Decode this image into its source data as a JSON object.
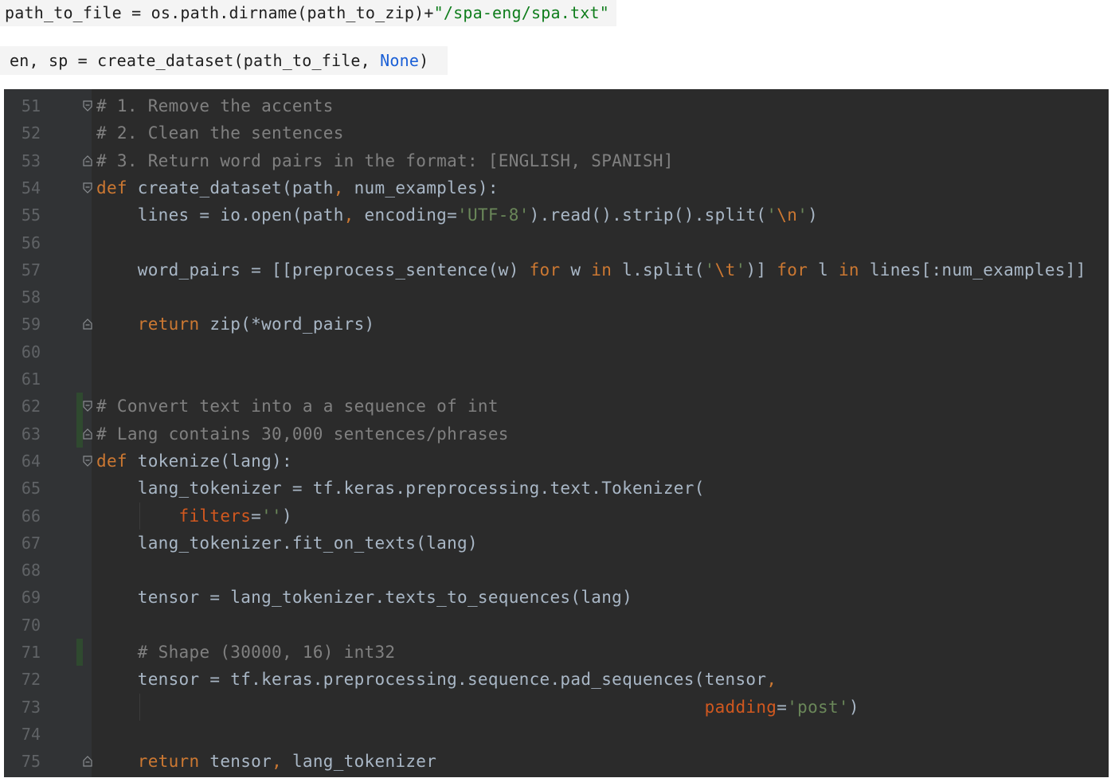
{
  "snippets": [
    {
      "parts": [
        {
          "text": "path_to_file = os.path.dirname(path_to_zip)+",
          "kind": "plain"
        },
        {
          "text": "\"/spa-eng/spa.txt\"",
          "kind": "string"
        }
      ]
    },
    {
      "parts": [
        {
          "text": "en, sp = create_dataset(path_to_file, ",
          "kind": "plain"
        },
        {
          "text": "None",
          "kind": "keyword"
        },
        {
          "text": ")",
          "kind": "plain"
        }
      ]
    }
  ],
  "editor": {
    "colors": {
      "background": "#2b2b2b",
      "gutter": "#313335",
      "text": "#a9b7c6",
      "comment": "#808080",
      "keyword": "#cc7832",
      "string": "#6a8759",
      "named_param": "#d1581f",
      "line_number": "#606366",
      "change_marker": "#2f4a2f"
    },
    "lines": [
      {
        "num": "51",
        "fold": "open",
        "tokens": [
          [
            "c",
            "# 1. Remove the accents"
          ]
        ]
      },
      {
        "num": "52",
        "tokens": [
          [
            "c",
            "# 2. Clean the sentences"
          ]
        ]
      },
      {
        "num": "53",
        "fold": "close",
        "tokens": [
          [
            "c",
            "# 3. Return word pairs in the format: [ENGLISH, SPANISH]"
          ]
        ]
      },
      {
        "num": "54",
        "fold": "open",
        "tokens": [
          [
            "k",
            "def "
          ],
          [
            "p",
            "create_dataset(path"
          ],
          [
            "k",
            ", "
          ],
          [
            "p",
            "num_examples):"
          ]
        ]
      },
      {
        "num": "55",
        "tokens": [
          [
            "p",
            "    lines = io.open(path"
          ],
          [
            "k",
            ", "
          ],
          [
            "p",
            "encoding="
          ],
          [
            "s",
            "'UTF-8'"
          ],
          [
            "p",
            ").read().strip().split("
          ],
          [
            "s",
            "'"
          ],
          [
            "k",
            "\\n"
          ],
          [
            "s",
            "'"
          ],
          [
            "p",
            ")"
          ]
        ]
      },
      {
        "num": "56",
        "tokens": []
      },
      {
        "num": "57",
        "tokens": [
          [
            "p",
            "    word_pairs = [[preprocess_sentence(w) "
          ],
          [
            "k",
            "for "
          ],
          [
            "p",
            "w "
          ],
          [
            "k",
            "in "
          ],
          [
            "p",
            "l.split("
          ],
          [
            "s",
            "'"
          ],
          [
            "k",
            "\\t"
          ],
          [
            "s",
            "'"
          ],
          [
            "p",
            ")] "
          ],
          [
            "k",
            "for "
          ],
          [
            "p",
            "l "
          ],
          [
            "k",
            "in "
          ],
          [
            "p",
            "lines[:num_examples]]"
          ]
        ]
      },
      {
        "num": "58",
        "tokens": []
      },
      {
        "num": "59",
        "fold": "close",
        "tokens": [
          [
            "p",
            "    "
          ],
          [
            "k",
            "return "
          ],
          [
            "p",
            "zip(*word_pairs)"
          ]
        ]
      },
      {
        "num": "60",
        "tokens": []
      },
      {
        "num": "61",
        "tokens": []
      },
      {
        "num": "62",
        "fold": "open",
        "changed": true,
        "tokens": [
          [
            "c",
            "# Convert text into a a sequence of int"
          ]
        ]
      },
      {
        "num": "63",
        "fold": "close",
        "changed": true,
        "tokens": [
          [
            "c",
            "# Lang contains 30,000 sentences/phrases"
          ]
        ]
      },
      {
        "num": "64",
        "fold": "open",
        "tokens": [
          [
            "k",
            "def "
          ],
          [
            "p",
            "tokenize(lang):"
          ]
        ]
      },
      {
        "num": "65",
        "tokens": [
          [
            "p",
            "    lang_tokenizer = tf.keras.preprocessing.text.Tokenizer("
          ]
        ]
      },
      {
        "num": "66",
        "guide": true,
        "tokens": [
          [
            "p",
            "        "
          ],
          [
            "n",
            "filters"
          ],
          [
            "p",
            "="
          ],
          [
            "s",
            "''"
          ],
          [
            "p",
            ")"
          ]
        ]
      },
      {
        "num": "67",
        "tokens": [
          [
            "p",
            "    lang_tokenizer.fit_on_texts(lang)"
          ]
        ]
      },
      {
        "num": "68",
        "tokens": []
      },
      {
        "num": "69",
        "tokens": [
          [
            "p",
            "    tensor = lang_tokenizer.texts_to_sequences(lang)"
          ]
        ]
      },
      {
        "num": "70",
        "tokens": []
      },
      {
        "num": "71",
        "changed": true,
        "tokens": [
          [
            "p",
            "    "
          ],
          [
            "c",
            "# Shape (30000, 16) int32"
          ]
        ]
      },
      {
        "num": "72",
        "tokens": [
          [
            "p",
            "    tensor = tf.keras.preprocessing.sequence.pad_sequences(tensor"
          ],
          [
            "k",
            ","
          ]
        ]
      },
      {
        "num": "73",
        "guide": true,
        "tokens": [
          [
            "p",
            "                                                           "
          ],
          [
            "n",
            "padding"
          ],
          [
            "p",
            "="
          ],
          [
            "s",
            "'post'"
          ],
          [
            "p",
            ")"
          ]
        ]
      },
      {
        "num": "74",
        "tokens": []
      },
      {
        "num": "75",
        "fold": "close",
        "tokens": [
          [
            "p",
            "    "
          ],
          [
            "k",
            "return "
          ],
          [
            "p",
            "tensor"
          ],
          [
            "k",
            ", "
          ],
          [
            "p",
            "lang_tokenizer"
          ]
        ]
      }
    ]
  }
}
